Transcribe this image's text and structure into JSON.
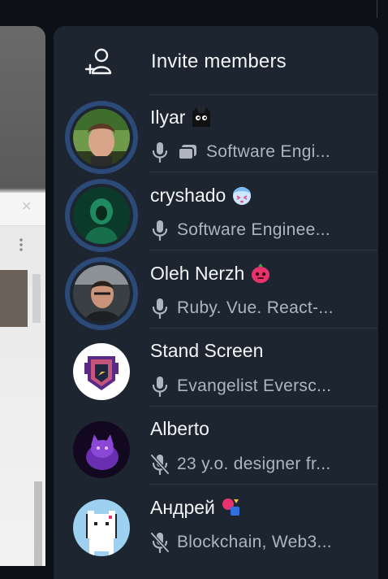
{
  "invite": {
    "label": "Invite members",
    "icon": "add-user-icon"
  },
  "members": [
    {
      "name": "Ilyar",
      "emoji": "black-cat-emoji",
      "status": "Software Engi...",
      "mic": "on",
      "screen_share": true,
      "speaking_ring": true
    },
    {
      "name": "cryshado",
      "emoji": "anime-face-emoji",
      "status": "Software Enginee...",
      "mic": "on",
      "screen_share": false,
      "speaking_ring": true
    },
    {
      "name": "Oleh Nerzh",
      "emoji": "red-blob-emoji",
      "status": "Ruby. Vue. React-...",
      "mic": "on",
      "screen_share": false,
      "speaking_ring": true
    },
    {
      "name": "Stand Screen",
      "emoji": "",
      "status": "Evangelist Eversc...",
      "mic": "on",
      "screen_share": false,
      "speaking_ring": false
    },
    {
      "name": "Alberto",
      "emoji": "",
      "status": "23 y.o. designer fr...",
      "mic": "muted",
      "screen_share": false,
      "speaking_ring": false
    },
    {
      "name": "Андрей",
      "emoji": "shapes-emoji",
      "status": "Blockchain, Web3...",
      "mic": "muted",
      "screen_share": false,
      "speaking_ring": false
    }
  ],
  "colors": {
    "panel": "#1c2530",
    "ring": "#2b4a78",
    "text": "#f2f4f6",
    "subtext": "#aeb5bf"
  }
}
